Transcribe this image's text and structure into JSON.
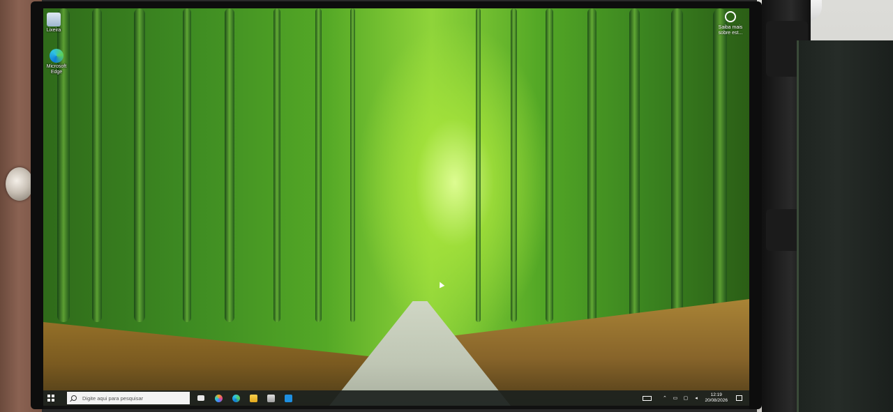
{
  "desktop": {
    "icons": [
      {
        "label": "Lixeira",
        "icon": "recycle-bin-icon"
      },
      {
        "label": "Microsoft Edge",
        "icon": "edge-icon"
      }
    ],
    "spotlight": {
      "label": "Saiba mais sobre est...",
      "icon": "camera-info-icon"
    }
  },
  "taskbar": {
    "search_placeholder": "Digite aqui para pesquisar",
    "apps": [
      "task-view-icon",
      "copilot-icon",
      "edge-icon",
      "file-explorer-icon",
      "store-icon",
      "mail-icon"
    ],
    "tray": {
      "time": "12:19",
      "date": "20/08/2026"
    }
  },
  "colors": {
    "taskbar": "#1c221e",
    "search_bg": "#f3f3f3",
    "wallpaper_accent": "#8fd43a"
  }
}
